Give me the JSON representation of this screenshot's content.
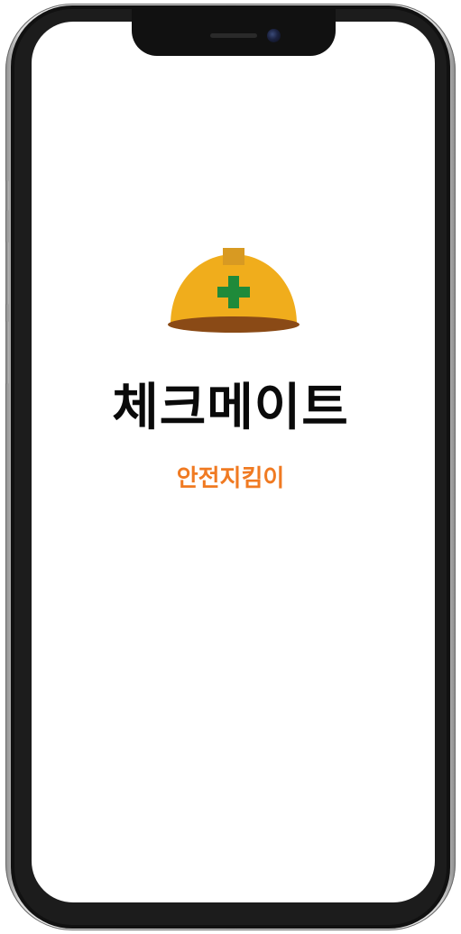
{
  "app": {
    "title": "체크메이트",
    "subtitle": "안전지킴이"
  },
  "logo": {
    "icon": "safety-helmet-icon",
    "colors": {
      "helmet": "#f0ad1c",
      "brim": "#8a4a16",
      "badge": "#d89a22",
      "cross": "#1f8a3a"
    }
  },
  "colors": {
    "subtitle": "#f07a22",
    "title": "#0a0a0a",
    "screen_background": "#ffffff"
  }
}
